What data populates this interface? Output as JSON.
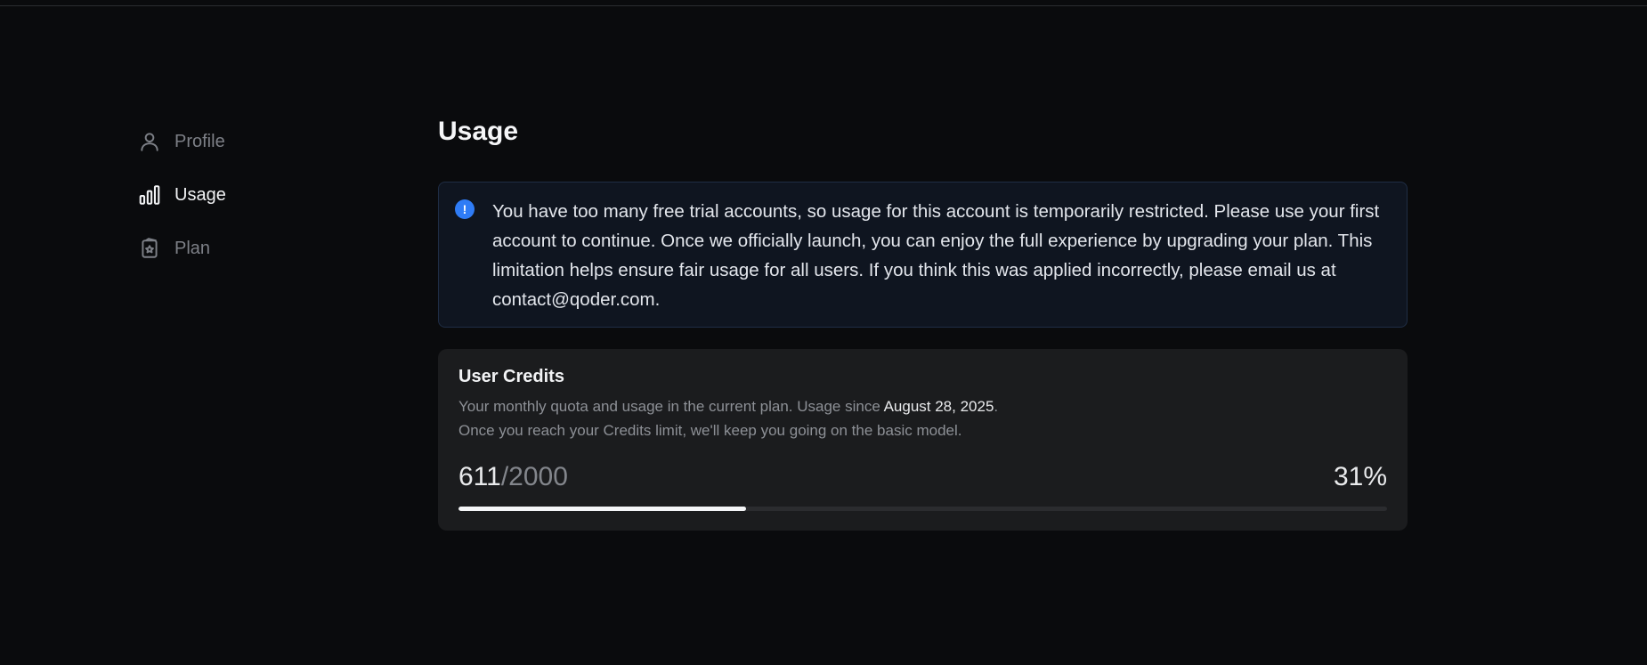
{
  "sidebar": {
    "items": [
      {
        "label": "Profile",
        "icon": "user-icon",
        "active": false
      },
      {
        "label": "Usage",
        "icon": "bar-chart-icon",
        "active": true
      },
      {
        "label": "Plan",
        "icon": "plan-icon",
        "active": false
      }
    ]
  },
  "main": {
    "title": "Usage",
    "alert": {
      "icon": "info-icon",
      "icon_glyph": "!",
      "text": "You have too many free trial accounts, so usage for this account is temporarily restricted. Please use your first account to continue. Once we officially launch, you can enjoy the full experience by upgrading your plan. This limitation helps ensure fair usage for all users. If you think this was applied incorrectly, please email us at contact@qoder.com."
    },
    "credits": {
      "title": "User Credits",
      "desc_line1": "Your monthly quota and usage in the current plan. Usage since ",
      "since_date": "August 28, 2025",
      "desc_line1_end": ".",
      "desc_line2": "Once you reach your Credits limit, we'll keep you going on the basic model.",
      "used": "611",
      "limit": "/2000",
      "percent_label": "31%",
      "progress_fraction": 0.31
    }
  },
  "colors": {
    "background": "#0a0b0d",
    "accent": "#2f7cf6",
    "card": "#1b1c1e"
  }
}
